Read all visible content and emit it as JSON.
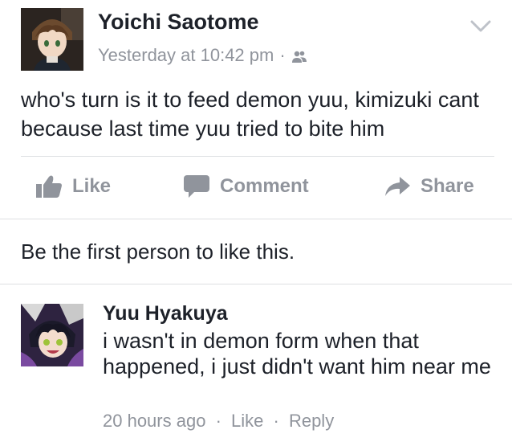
{
  "post": {
    "author": "Yoichi Saotome",
    "timestamp": "Yesterday at 10:42 pm",
    "separator": "·",
    "audience_icon": "friends-icon",
    "menu_icon": "chevron-down-icon",
    "text": "who's turn is it to feed demon yuu, kimizuki cant because last time yuu tried to bite him"
  },
  "actions": {
    "like": {
      "label": "Like",
      "icon": "thumbs-up-icon"
    },
    "comment": {
      "label": "Comment",
      "icon": "speech-bubble-icon"
    },
    "share": {
      "label": "Share",
      "icon": "share-arrow-icon"
    }
  },
  "likes_summary": "Be the first person to like this.",
  "comment": {
    "author": "Yuu Hyakuya",
    "text": "i wasn't in demon form when that happened, i just didn't want him near me",
    "time": "20 hours ago",
    "separator": "·",
    "like_label": "Like",
    "reply_label": "Reply"
  },
  "colors": {
    "text_primary": "#1d2129",
    "text_secondary": "#90949c",
    "divider": "#dddfe2",
    "background": "#ffffff"
  }
}
